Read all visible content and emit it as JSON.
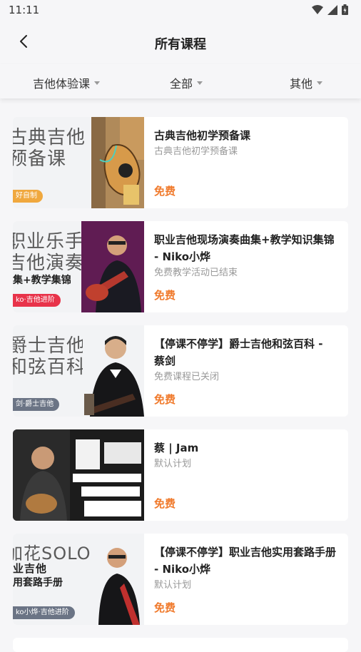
{
  "status": {
    "time": "11:11"
  },
  "header": {
    "title": "所有课程"
  },
  "filters": [
    {
      "label": "吉他体验课"
    },
    {
      "label": "全部"
    },
    {
      "label": "其他"
    }
  ],
  "courses": [
    {
      "title": "古典吉他初学预备课",
      "desc": "古典吉他初学预备课",
      "price": "免费",
      "thumb_line1": "古典吉他",
      "thumb_line2": "预备课",
      "thumb_sub": "",
      "badge": "好自制",
      "badge_color": "#f0a83e"
    },
    {
      "title": "职业吉他现场演奏曲集+教学知识集锦 - Niko小烨",
      "desc": "免费教学活动已结束",
      "price": "免费",
      "thumb_line1": "职业乐手",
      "thumb_line2": "吉他演奏",
      "thumb_sub": "集+教学集锦",
      "badge": "ko·吉他进阶",
      "badge_color": "#e8334a"
    },
    {
      "title": "【停课不停学】爵士吉他和弦百科 - 蔡剑",
      "desc": "免费课程已关闭",
      "price": "免费",
      "thumb_line1": "爵士吉他",
      "thumb_line2": "和弦百科",
      "thumb_sub": "",
      "badge": "剑·爵士吉他",
      "badge_color": "#6b7485"
    },
    {
      "title": "蔡 | Jam",
      "desc": "默认计划",
      "price": "免费",
      "thumb_line1": "",
      "thumb_line2": "",
      "thumb_sub": "",
      "badge": "",
      "badge_color": "#000000"
    },
    {
      "title": "【停课不停学】职业吉他实用套路手册 - Niko小烨",
      "desc": "默认计划",
      "price": "免费",
      "thumb_line1": "加花SOLO",
      "thumb_line2": "业吉他",
      "thumb_sub": "用套路手册",
      "badge": "ko小烨·吉他进阶",
      "badge_color": "#6b7485"
    }
  ],
  "colors": {
    "accent": "#f07a2c",
    "background": "#f6f6f8"
  }
}
